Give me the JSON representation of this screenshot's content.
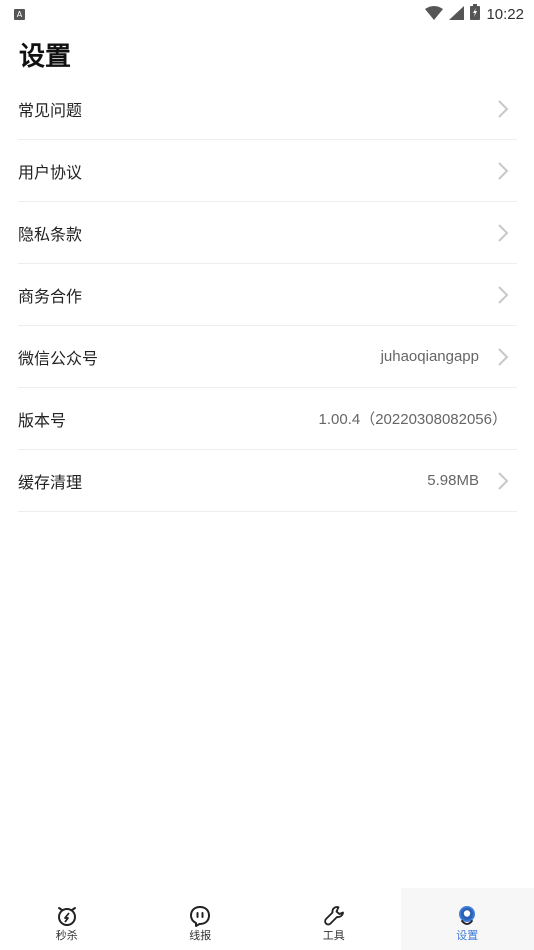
{
  "status_bar": {
    "notification_icon": "notification-a-icon",
    "notification_text": "A",
    "time": "10:22",
    "icons": [
      "wifi-icon",
      "signal-icon",
      "battery-icon"
    ]
  },
  "page": {
    "title": "设置"
  },
  "settings": {
    "items": [
      {
        "label": "常见问题",
        "value": "",
        "has_chevron": true
      },
      {
        "label": "用户协议",
        "value": "",
        "has_chevron": true
      },
      {
        "label": "隐私条款",
        "value": "",
        "has_chevron": true
      },
      {
        "label": "商务合作",
        "value": "",
        "has_chevron": true
      },
      {
        "label": "微信公众号",
        "value": "juhaoqiangapp",
        "has_chevron": true
      },
      {
        "label": "版本号",
        "value": "1.00.4（20220308082056）",
        "has_chevron": false
      },
      {
        "label": "缓存清理",
        "value": "5.98MB",
        "has_chevron": true
      }
    ]
  },
  "bottom_nav": {
    "items": [
      {
        "label": "秒杀",
        "icon": "alarm-clock-icon",
        "active": false
      },
      {
        "label": "线报",
        "icon": "message-bubble-icon",
        "active": false
      },
      {
        "label": "工具",
        "icon": "wrench-icon",
        "active": false
      },
      {
        "label": "设置",
        "icon": "settings-avatar-icon",
        "active": true
      }
    ]
  },
  "colors": {
    "accent": "#3d7bd9",
    "chevron": "#c8c8c8",
    "divider": "#eeeeee"
  }
}
